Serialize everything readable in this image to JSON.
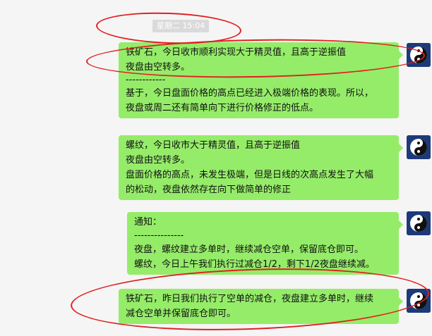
{
  "timestamp": "星期二 15:04",
  "messages": [
    {
      "lines": [
        "铁矿石，今日收市顺利实现大于精灵值，且高于逆振值",
        "夜盘由空转多。",
        "------------",
        "基于，今日盘面价格的高点已经进入极端价格的表现。所以，",
        "夜盘或周二还有简单向下进行价格修正的低点。"
      ]
    },
    {
      "lines": [
        "螺纹，今日收市大于精灵值，且高于逆振值",
        "夜盘由空转多。",
        "盘面价格的高点，未发生极端，但是日线的次高点发生了大幅",
        "的松动，夜盘依然存在向下做简单的修正"
      ]
    },
    {
      "lines": [
        "通知：",
        "---------------",
        "夜盘，螺纹建立多单时，继续减仓空单，保留底仓即可。",
        "螺纹，今日上午我们执行过减仓1/2，剩下1/2夜盘继续减。"
      ]
    },
    {
      "lines": [
        "铁矿石，昨日我们执行了空单的减仓，夜盘建立多单时，继续",
        "减仓空单并保留底仓即可。"
      ]
    }
  ],
  "colors": {
    "bubble": "#95ec69",
    "background": "#f5f5f5",
    "annotation": "#e02020",
    "avatar": "#1c3a7a"
  }
}
